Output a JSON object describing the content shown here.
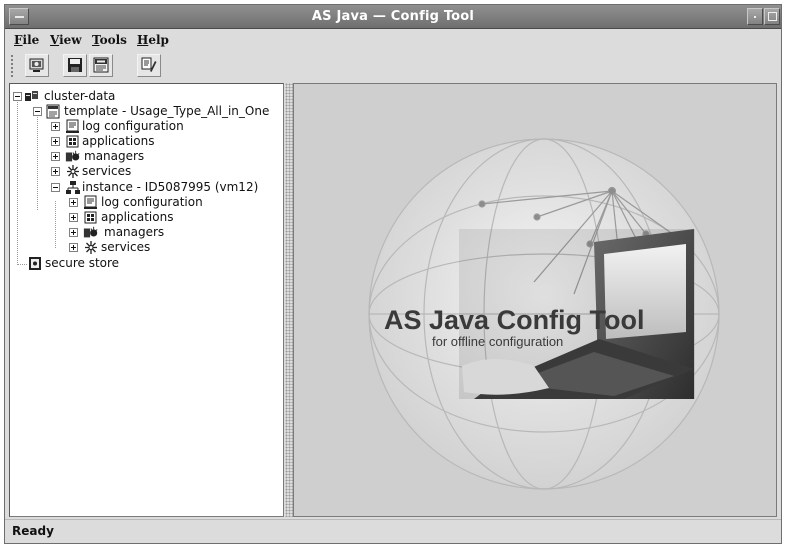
{
  "window": {
    "title": "AS Java — Config Tool"
  },
  "menubar": {
    "file": {
      "accel": "F",
      "rest": "ile"
    },
    "view": {
      "accel": "V",
      "rest": "iew"
    },
    "tools": {
      "accel": "T",
      "rest": "ools"
    },
    "help": {
      "accel": "H",
      "rest": "elp"
    }
  },
  "toolbar": {
    "buttons": [
      {
        "icon": "connect-icon"
      },
      {
        "icon": "save-icon"
      },
      {
        "icon": "export-xml-icon"
      },
      {
        "icon": "edit-icon"
      }
    ]
  },
  "tree": {
    "cluster": "cluster-data",
    "template": "template - Usage_Type_All_in_One",
    "template_children": [
      "log configuration",
      "applications",
      "managers",
      "services"
    ],
    "instance": "instance - ID5087995 (vm12)",
    "instance_children": [
      "log configuration",
      "applications",
      "managers",
      "services"
    ],
    "secure_store": "secure store"
  },
  "splash": {
    "title": "AS Java Config Tool",
    "subtitle": "for offline configuration"
  },
  "status": {
    "text": "Ready"
  },
  "colors": {
    "titlebar": "#7c7c7c",
    "workspace": "#cfcfcf",
    "window": "#dcdcdc"
  }
}
